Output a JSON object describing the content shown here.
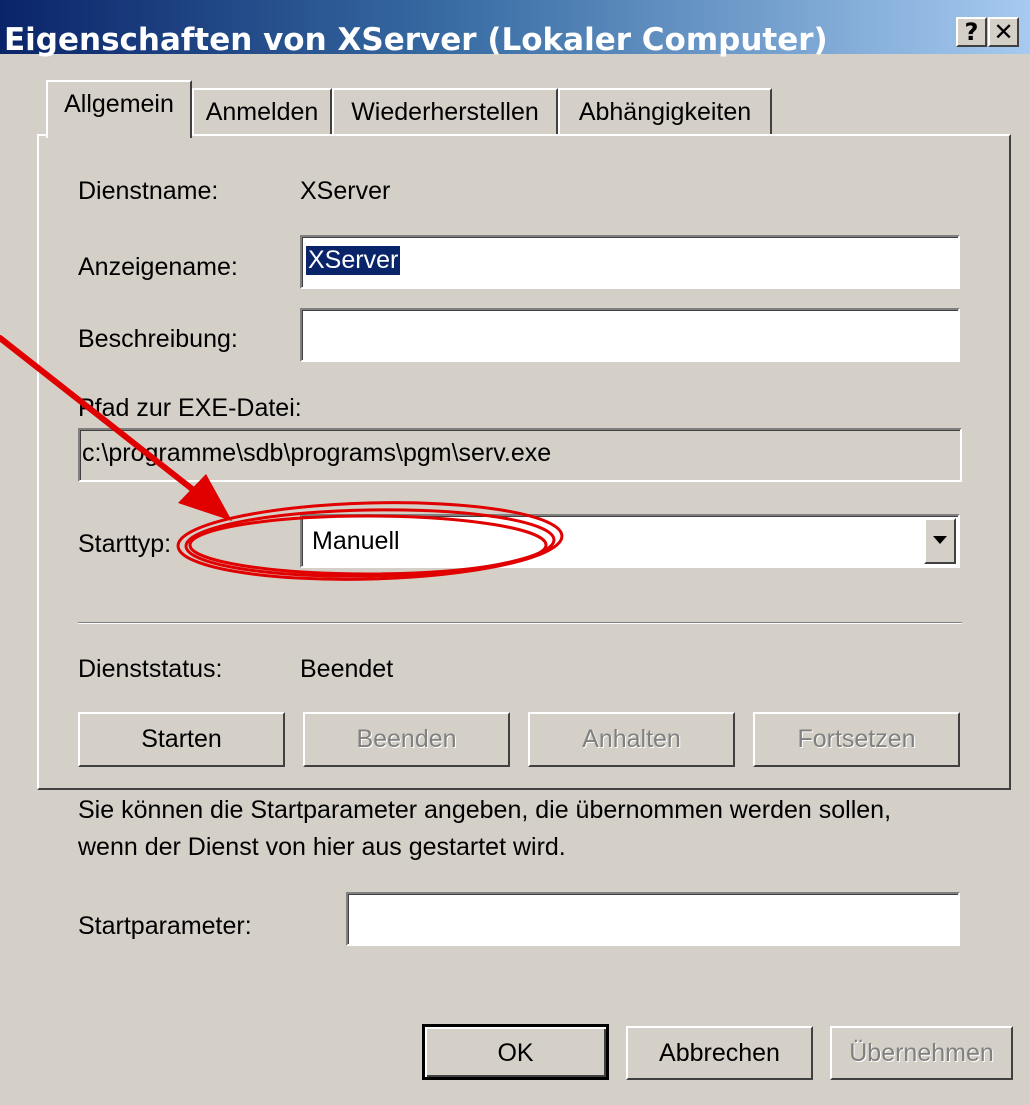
{
  "window": {
    "title": "Eigenschaften von XServer (Lokaler Computer)",
    "help_label": "?",
    "close_label": "✕"
  },
  "tabs": [
    {
      "label": "Allgemein",
      "active": true
    },
    {
      "label": "Anmelden",
      "active": false
    },
    {
      "label": "Wiederherstellen",
      "active": false
    },
    {
      "label": "Abhängigkeiten",
      "active": false
    }
  ],
  "general": {
    "service_name_label": "Dienstname:",
    "service_name_value": "XServer",
    "display_name_label": "Anzeigename:",
    "display_name_value": "XServer",
    "description_label": "Beschreibung:",
    "description_value": "",
    "exe_path_label": "Pfad zur EXE-Datei:",
    "exe_path_value": "c:\\programme\\sdb\\programs\\pgm\\serv.exe",
    "start_type_label": "Starttyp:",
    "start_type_value": "Manuell",
    "status_label": "Dienststatus:",
    "status_value": "Beendet",
    "buttons": {
      "start": "Starten",
      "stop": "Beenden",
      "pause": "Anhalten",
      "resume": "Fortsetzen"
    },
    "hint_line1": "Sie können die Startparameter angeben, die übernommen werden sollen,",
    "hint_line2": "wenn der Dienst von hier aus gestartet wird.",
    "start_params_label": "Startparameter:",
    "start_params_value": ""
  },
  "footer": {
    "ok": "OK",
    "cancel": "Abbrechen",
    "apply": "Übernehmen"
  },
  "colors": {
    "face": "#d4d0c8",
    "title_start": "#0a246a",
    "title_end": "#a6caf0",
    "annotation": "#e00000",
    "selection": "#0a246a"
  }
}
